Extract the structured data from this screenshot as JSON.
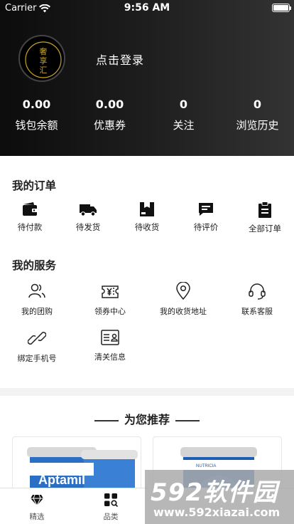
{
  "status_bar": {
    "carrier": "Carrier",
    "time": "9:56 AM"
  },
  "profile": {
    "avatar_text": "奢享汇",
    "login_text": "点击登录"
  },
  "stats": [
    {
      "value": "0.00",
      "label": "钱包余额"
    },
    {
      "value": "0.00",
      "label": "优惠券"
    },
    {
      "value": "0",
      "label": "关注"
    },
    {
      "value": "0",
      "label": "浏览历史"
    }
  ],
  "orders": {
    "title": "我的订单",
    "items": [
      {
        "label": "待付款",
        "icon": "wallet-icon"
      },
      {
        "label": "待发货",
        "icon": "truck-icon"
      },
      {
        "label": "待收货",
        "icon": "package-icon"
      },
      {
        "label": "待评价",
        "icon": "comment-icon"
      },
      {
        "label": "全部订单",
        "icon": "clipboard-icon"
      }
    ]
  },
  "services": {
    "title": "我的服务",
    "items": [
      {
        "label": "我的团购",
        "icon": "group-icon"
      },
      {
        "label": "领券中心",
        "icon": "coupon-icon"
      },
      {
        "label": "我的收货地址",
        "icon": "location-icon"
      },
      {
        "label": "联系客服",
        "icon": "headset-icon"
      },
      {
        "label": "绑定手机号",
        "icon": "link-icon"
      },
      {
        "label": "清关信息",
        "icon": "id-card-icon"
      }
    ]
  },
  "recommend": {
    "title": "为您推荐",
    "products": [
      {
        "brand": "Aptamil"
      },
      {
        "brand": "NUTRICIA"
      }
    ]
  },
  "tabbar": [
    {
      "label": "精选",
      "icon": "diamond-icon"
    },
    {
      "label": "品类",
      "icon": "category-icon"
    }
  ],
  "watermark": {
    "brand": "592软件园",
    "url": "www.592xiazai.com"
  },
  "colors": {
    "header_start": "#0c0c0c",
    "header_end": "#333333",
    "accent": "#222222"
  }
}
